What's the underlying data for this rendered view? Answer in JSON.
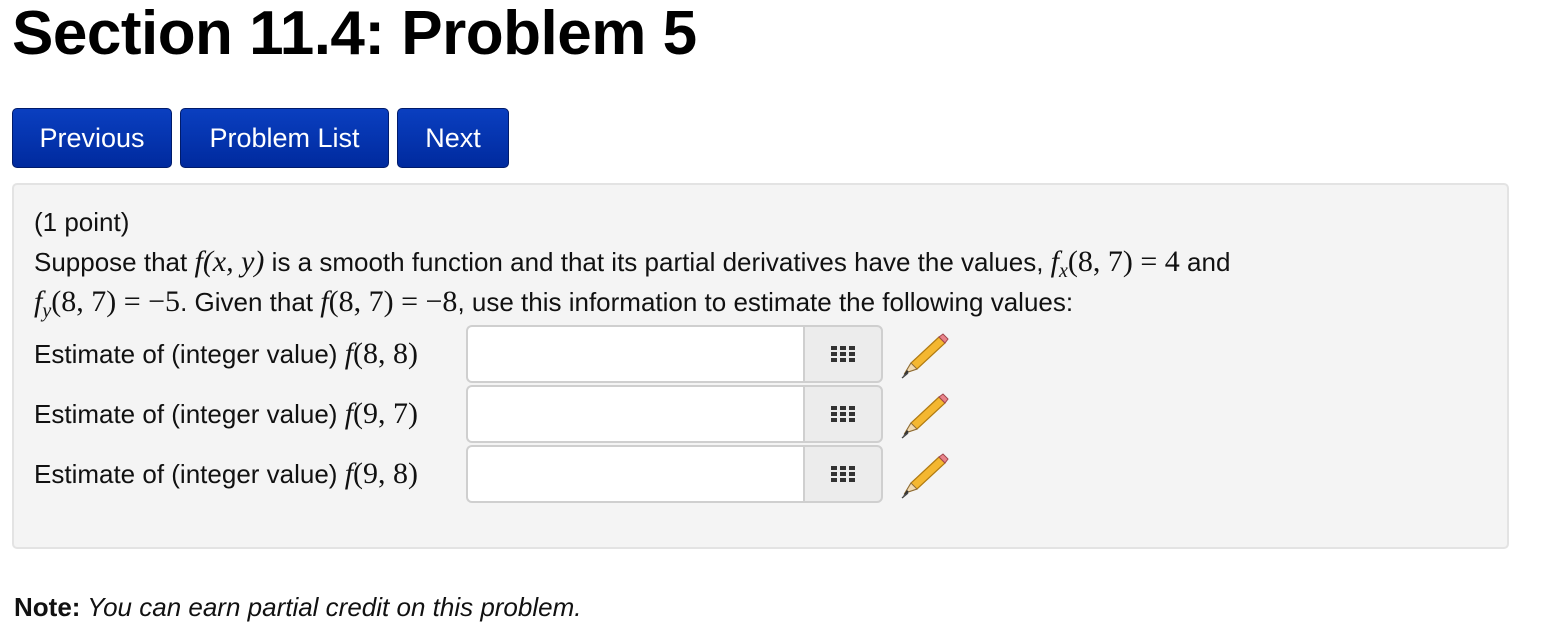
{
  "page": {
    "title": "Section 11.4: Problem 5"
  },
  "nav": {
    "previous": "Previous",
    "problem_list": "Problem List",
    "next": "Next"
  },
  "problem": {
    "points": "(1 point)",
    "line1": {
      "t1": "Suppose that",
      "m1_f": "f",
      "m1_args": "(x, y)",
      "t2": " is a smooth function and that its partial derivatives have the values,",
      "m2_f": "f",
      "m2_sub": "x",
      "m2_rest": "(8, 7) = 4",
      "t3": " and"
    },
    "line2": {
      "m1_f": "f",
      "m1_sub": "y",
      "m1_rest": "(8, 7) = −5",
      "t1": ". Given that",
      "m2_f": "f",
      "m2_rest": "(8, 7) = −8",
      "t2": ", use this information to estimate the following values:"
    },
    "answers": [
      {
        "label": "Estimate of (integer value)",
        "f": "f",
        "args": "(8, 8)",
        "value": ""
      },
      {
        "label": "Estimate of (integer value)",
        "f": "f",
        "args": "(9, 7)",
        "value": ""
      },
      {
        "label": "Estimate of (integer value)",
        "f": "f",
        "args": "(9, 8)",
        "value": ""
      }
    ]
  },
  "note": {
    "label": "Note:",
    "text": " You can earn partial credit on this problem."
  },
  "icons": {
    "keypad": "keypad-grid-icon",
    "pencil": "pencil-icon"
  }
}
